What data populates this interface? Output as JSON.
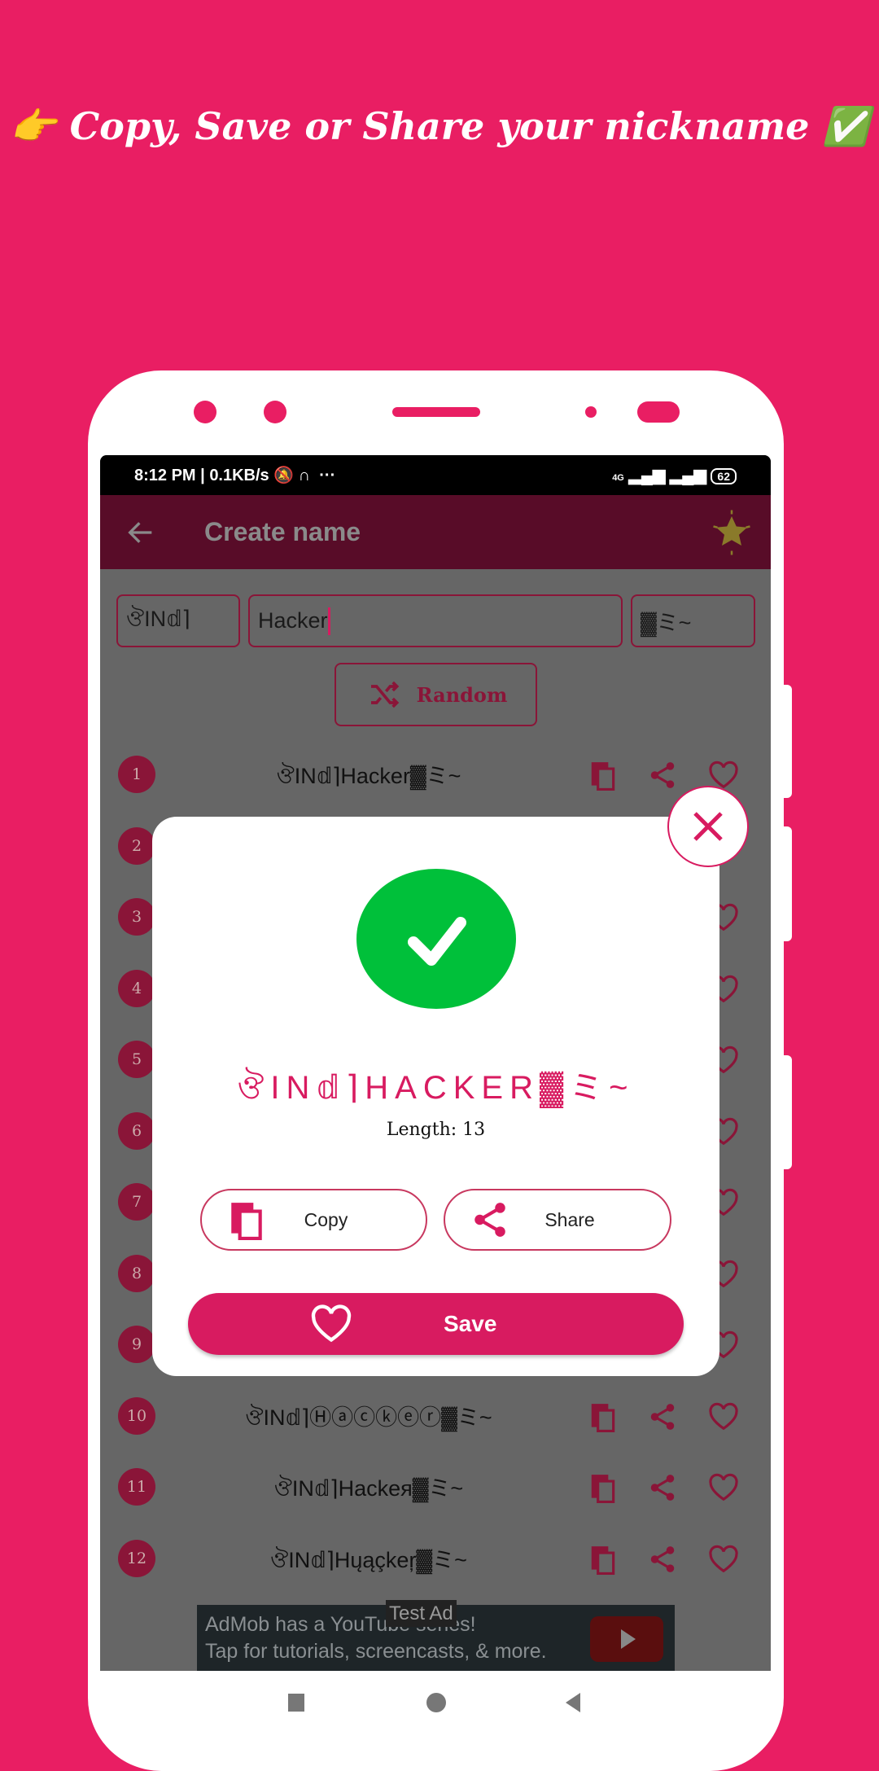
{
  "headline": {
    "emoji_left": "👉",
    "text": "Copy, Save or Share your nickname",
    "emoji_right": "✅"
  },
  "status_bar": {
    "time": "8:12 PM",
    "speed": "0.1KB/s",
    "network": "4G",
    "battery": "62"
  },
  "app_bar": {
    "title": "Create name",
    "back_icon": "arrow-left-icon",
    "action_icon": "star-sparkle-icon"
  },
  "inputs": {
    "prefix": "ঔIN𝕕⌉",
    "name": "Hacker",
    "suffix": "▓ミ~"
  },
  "random_label": "Random",
  "rows": [
    {
      "n": "1",
      "name": "ঔIN𝕕⌉Hacker▓ミ~"
    },
    {
      "n": "2",
      "name": ""
    },
    {
      "n": "3",
      "name": ""
    },
    {
      "n": "4",
      "name": ""
    },
    {
      "n": "5",
      "name": ""
    },
    {
      "n": "6",
      "name": ""
    },
    {
      "n": "7",
      "name": ""
    },
    {
      "n": "8",
      "name": ""
    },
    {
      "n": "9",
      "name": ""
    },
    {
      "n": "10",
      "name": "ঔIN𝕕⌉Ⓗⓐⓒⓚⓔⓡ▓ミ~"
    },
    {
      "n": "11",
      "name": "ঔIN𝕕⌉Hackeя▓ミ~"
    },
    {
      "n": "12",
      "name": "ঔIN𝕕⌉Hųąçkeŗ▓ミ~"
    }
  ],
  "ad": {
    "line1": "AdMob has a YouTube series!",
    "line2": "Tap for tutorials, screencasts, & more.",
    "badge": "Test Ad"
  },
  "dialog": {
    "nickname": "ঔIN𝕕⌉HACKER▓ミ~",
    "length": "Length: 13",
    "copy": "Copy",
    "share": "Share",
    "save": "Save"
  },
  "colors": {
    "background": "#E91E63",
    "accent": "#D81B60",
    "success": "#00C03A",
    "overlay": "#666666"
  }
}
